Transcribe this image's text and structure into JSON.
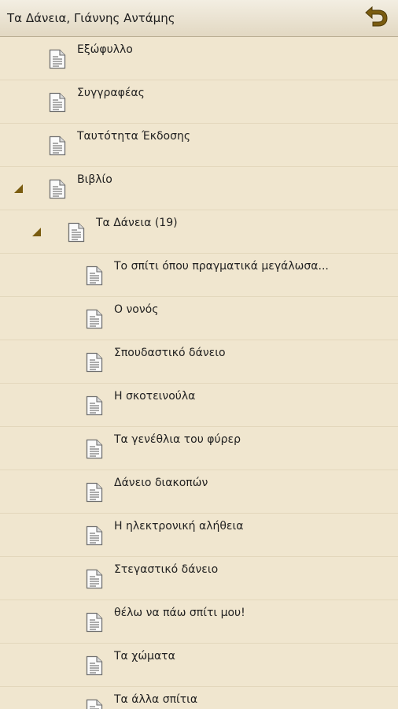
{
  "header": {
    "title": "Τα Δάνεια, Γιάννης Αντάμης",
    "back_icon": "back-arrow-icon"
  },
  "colors": {
    "background": "#f0e6cf",
    "header_top": "#f3eee2",
    "header_bottom": "#e2d8c2",
    "accent": "#7a5c10",
    "divider": "#e3d7bc"
  },
  "toc": {
    "items": [
      {
        "label": "Εξώφυλλο",
        "level": 1,
        "expanded": false
      },
      {
        "label": "Συγγραφέας",
        "level": 1,
        "expanded": false
      },
      {
        "label": "Ταυτότητα Έκδοσης",
        "level": 1,
        "expanded": false
      },
      {
        "label": "Βιβλίο",
        "level": 1,
        "expanded": true
      },
      {
        "label": "Τα Δάνεια (19)",
        "level": 2,
        "expanded": true
      },
      {
        "label": "Το σπίτι όπου πραγματικά μεγάλωσα...",
        "level": 3,
        "expanded": false
      },
      {
        "label": "Ο νονός",
        "level": 3,
        "expanded": false
      },
      {
        "label": "Σπουδαστικό δάνειο",
        "level": 3,
        "expanded": false
      },
      {
        "label": "Η σκοτεινούλα",
        "level": 3,
        "expanded": false
      },
      {
        "label": "Τα γενέθλια του φύρερ",
        "level": 3,
        "expanded": false
      },
      {
        "label": "Δάνειο διακοπών",
        "level": 3,
        "expanded": false
      },
      {
        "label": "Η ηλεκτρονική αλήθεια",
        "level": 3,
        "expanded": false
      },
      {
        "label": "Στεγαστικό δάνειο",
        "level": 3,
        "expanded": false
      },
      {
        "label": "θέλω να πάω σπίτι μου!",
        "level": 3,
        "expanded": false
      },
      {
        "label": "Τα χώματα",
        "level": 3,
        "expanded": false
      },
      {
        "label": "Τα άλλα σπίτια",
        "level": 3,
        "expanded": false
      }
    ]
  }
}
